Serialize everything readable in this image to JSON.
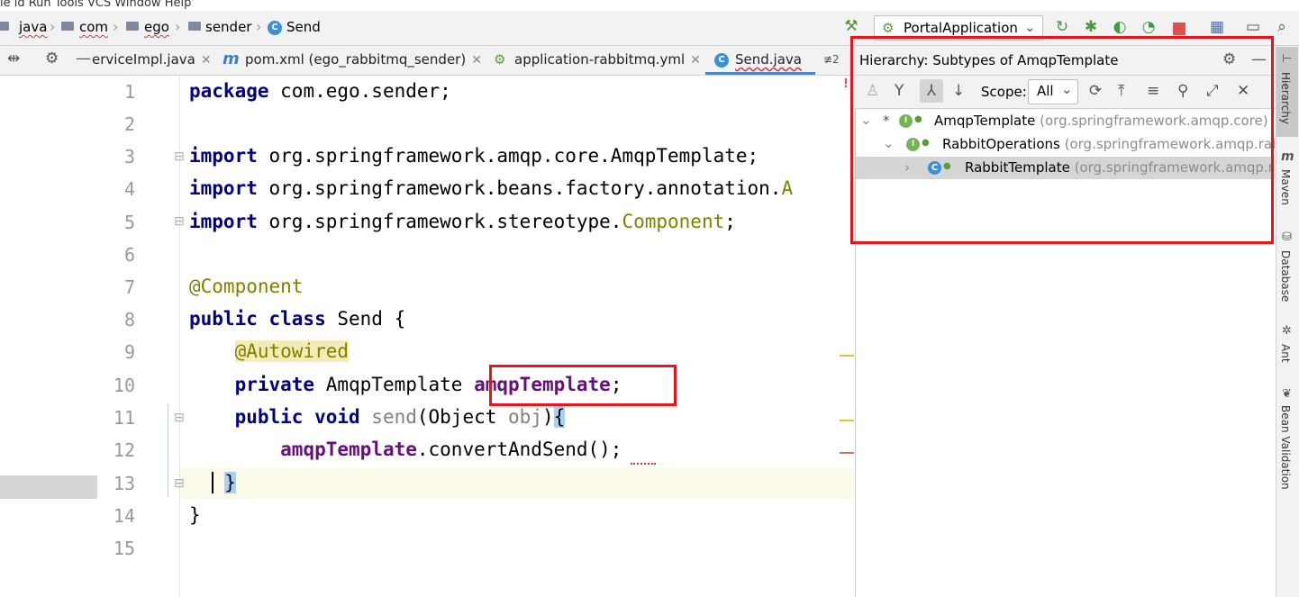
{
  "menu_fragment": "ie ld  Run  Tools  VCS  Window  Help",
  "breadcrumbs": [
    {
      "label": "java"
    },
    {
      "label": "com"
    },
    {
      "label": "ego"
    },
    {
      "label": "sender"
    },
    {
      "label": "Send"
    }
  ],
  "run_config": {
    "label": "PortalApplication"
  },
  "tabs": [
    {
      "label": "erviceImpl.java"
    },
    {
      "label": "pom.xml (ego_rabbitmq_sender)"
    },
    {
      "label": "application-rabbitmq.yml"
    },
    {
      "label": "Send.java"
    }
  ],
  "tabs_overflow": "≢2",
  "editor": {
    "line_numbers": [
      "1",
      "2",
      "3",
      "4",
      "5",
      "6",
      "7",
      "8",
      "9",
      "10",
      "11",
      "12",
      "13",
      "14",
      "15"
    ],
    "lines": {
      "l1_kw": "package",
      "l1_rest": " com.ego.sender;",
      "l3_kw": "import",
      "l3_rest": " org.springframework.amqp.core.AmqpTemplate;",
      "l4_kw": "import",
      "l4_rest": " org.springframework.beans.factory.annotation.",
      "l4_tail": "A",
      "l5_kw": "import",
      "l5_rest": " org.springframework.stereotype.",
      "l5_ann": "Component",
      "l5_end": ";",
      "l7_ann": "@Component",
      "l8_kw": "public class",
      "l8_rest": " Send {",
      "l9_ann": "@Autowired",
      "l10_kw": "private",
      "l10_rest": " AmqpTemplate ",
      "l10_fld": "amqpTemplate",
      "l10_end": ";",
      "l11_kw": "public void",
      "l11_name": " send",
      "l11_open": "(Object ",
      "l11_param": "obj",
      "l11_close": ")",
      "l11_brace": "{",
      "l12_fld": "amqpTemplate",
      "l12_rest": ".convertAndSend();",
      "l13_brace": "}",
      "l14_brace": "}"
    }
  },
  "hierarchy": {
    "title": "Hierarchy:  Subtypes of AmqpTemplate",
    "scope_label": "Scope:",
    "scope_value": "All",
    "nodes": [
      {
        "name": "AmqpTemplate",
        "pkg": " (org.springframework.amqp.core)",
        "marker": "*"
      },
      {
        "name": "RabbitOperations",
        "pkg": " (org.springframework.amqp.rabbit.core)"
      },
      {
        "name": "RabbitTemplate",
        "pkg": " (org.springframework.amqp.rabbit.core)"
      }
    ]
  },
  "side_tabs": [
    "Hierarchy",
    "Maven",
    "Database",
    "Ant",
    "Bean Validation"
  ],
  "colors": {
    "highlight": "#e8131b",
    "keyword": "#000080",
    "annotation": "#808000",
    "field": "#660e7a"
  }
}
